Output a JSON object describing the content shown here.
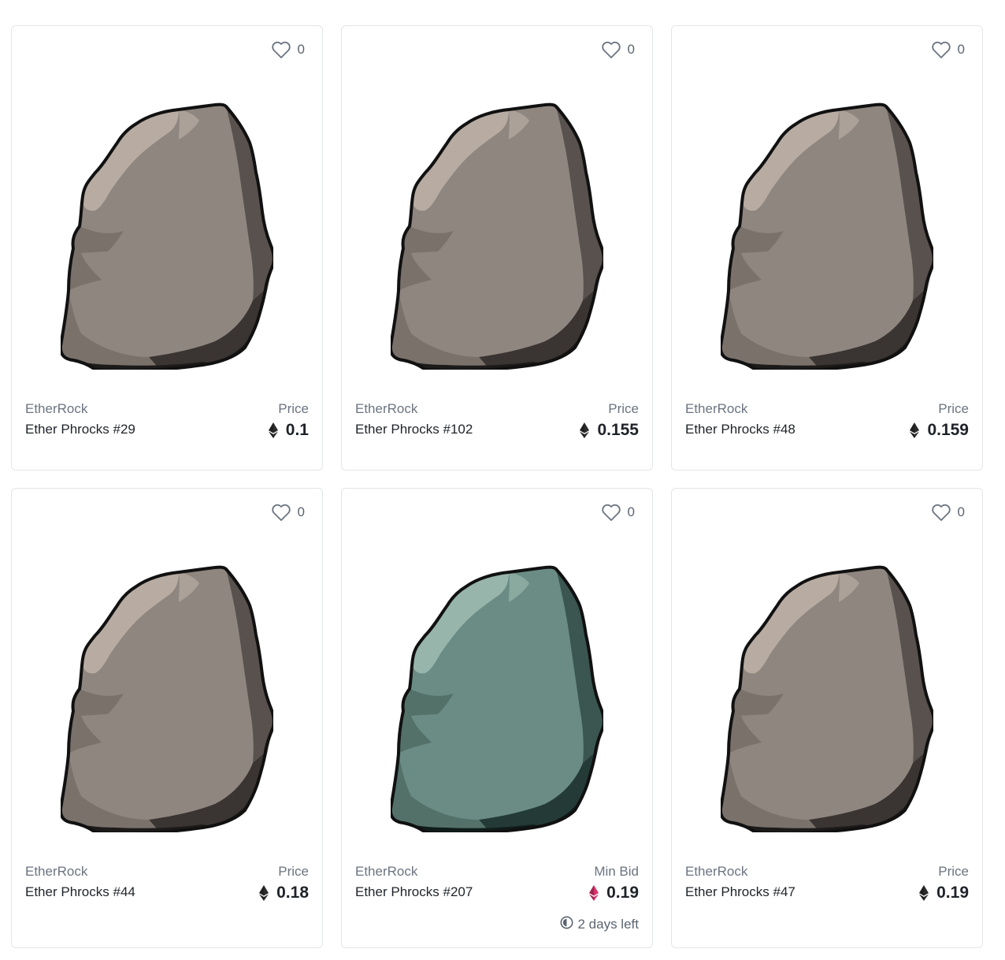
{
  "colors": {
    "gray_rock": {
      "base": "#8f8680",
      "light": "#b8aca2",
      "mid": "#7a716b",
      "shade": "#58514d",
      "dark": "#3a3532",
      "darkest": "#1d1b1a"
    },
    "teal_rock": {
      "base": "#6a8c84",
      "light": "#98b5ab",
      "mid": "#537169",
      "shade": "#3b5650",
      "dark": "#243a36",
      "darkest": "#0f1c1a"
    },
    "eth_default": "#2b2b2b",
    "eth_bid": "#d6336c"
  },
  "cards": [
    {
      "likes": "0",
      "collection": "EtherRock",
      "name": "Ether Phrocks #29",
      "price_label": "Price",
      "price": "0.1",
      "rock": "gray_rock",
      "eth": "eth_default"
    },
    {
      "likes": "0",
      "collection": "EtherRock",
      "name": "Ether Phrocks #102",
      "price_label": "Price",
      "price": "0.155",
      "rock": "gray_rock",
      "eth": "eth_default"
    },
    {
      "likes": "0",
      "collection": "EtherRock",
      "name": "Ether Phrocks #48",
      "price_label": "Price",
      "price": "0.159",
      "rock": "gray_rock",
      "eth": "eth_default"
    },
    {
      "likes": "0",
      "collection": "EtherRock",
      "name": "Ether Phrocks #44",
      "price_label": "Price",
      "price": "0.18",
      "rock": "gray_rock",
      "eth": "eth_default"
    },
    {
      "likes": "0",
      "collection": "EtherRock",
      "name": "Ether Phrocks #207",
      "price_label": "Min Bid",
      "price": "0.19",
      "rock": "teal_rock",
      "eth": "eth_bid",
      "time_left": "2 days left"
    },
    {
      "likes": "0",
      "collection": "EtherRock",
      "name": "Ether Phrocks #47",
      "price_label": "Price",
      "price": "0.19",
      "rock": "gray_rock",
      "eth": "eth_default"
    }
  ]
}
